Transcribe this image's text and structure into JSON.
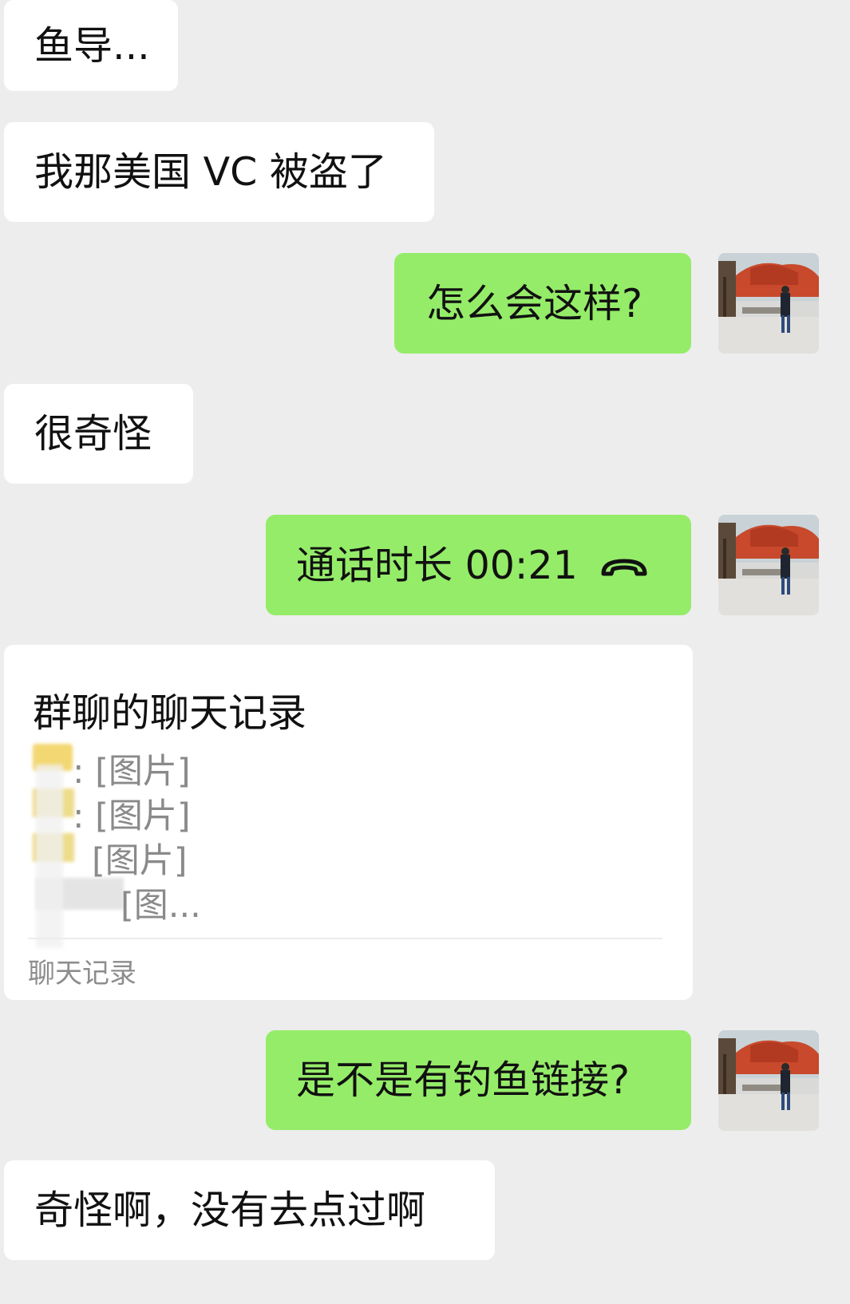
{
  "messages": {
    "m1": "鱼导...",
    "m2": "我那美国 VC 被盗了",
    "m3": "怎么会这样?",
    "m4": "很奇怪",
    "m5_call": "通话时长 00:21",
    "m7": "是不是有钓鱼链接?",
    "m8": "奇怪啊，没有去点过啊"
  },
  "chat_record_card": {
    "title": "群聊的聊天记录",
    "lines": [
      ": [图片]",
      ": [图片]",
      "[图片]",
      "[图..."
    ],
    "footer": "聊天记录"
  },
  "colors": {
    "background": "#ededed",
    "incoming_bubble": "#ffffff",
    "outgoing_bubble": "#95ec69"
  }
}
